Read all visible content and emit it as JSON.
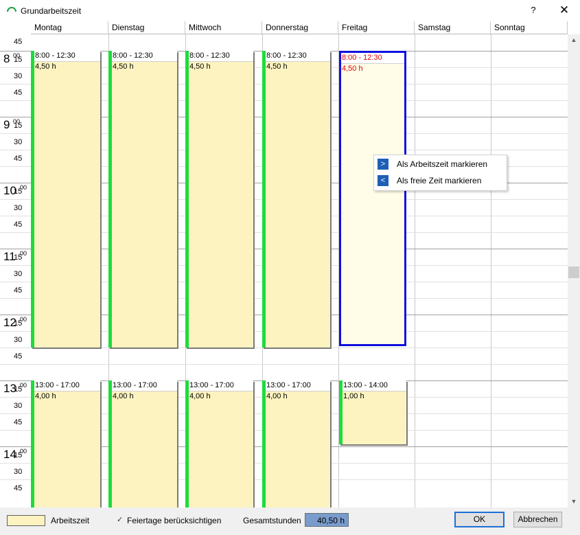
{
  "window": {
    "title": "Grundarbeitszeit",
    "help": "?",
    "close": "✕"
  },
  "days": [
    "Montag",
    "Dienstag",
    "Mittwoch",
    "Donnerstag",
    "Freitag",
    "Samstag",
    "Sonntag"
  ],
  "time_gutter": {
    "first_label": "45",
    "hours": [
      "8",
      "9",
      "10",
      "11",
      "12",
      "13",
      "14"
    ],
    "hour_superscript": "00",
    "quarter_labels": [
      "15",
      "30",
      "45"
    ]
  },
  "appointments": {
    "morning": {
      "time": "8:00 - 12:30",
      "hours": "4,50 h"
    },
    "afternoon": {
      "time": "13:00 - 17:00",
      "hours": "4,00 h"
    },
    "friday_morning": {
      "time": "8:00 - 12:30",
      "hours": "4,50 h"
    },
    "friday_afternoon": {
      "time": "13:00 - 14:00",
      "hours": "1,00 h"
    }
  },
  "context_menu": {
    "item1": {
      "icon": ">",
      "label": "Als Arbeitszeit markieren"
    },
    "item2": {
      "icon": "<",
      "label": "Als freie Zeit markieren"
    }
  },
  "footer": {
    "legend_label": "Arbeitszeit",
    "holiday_check": "✓",
    "holiday_label": "Feiertage berücksichtigen",
    "total_label": "Gesamtstunden",
    "total_value": "40,50 h",
    "ok": "OK",
    "cancel": "Abbrechen"
  },
  "scrollbar": {
    "up": "▲",
    "down": "▼"
  },
  "colors": {
    "work": "#fdf3c0",
    "accent_green": "#1cdc3c",
    "selection": "#1010e0",
    "total_bg": "#7a9ccc"
  }
}
